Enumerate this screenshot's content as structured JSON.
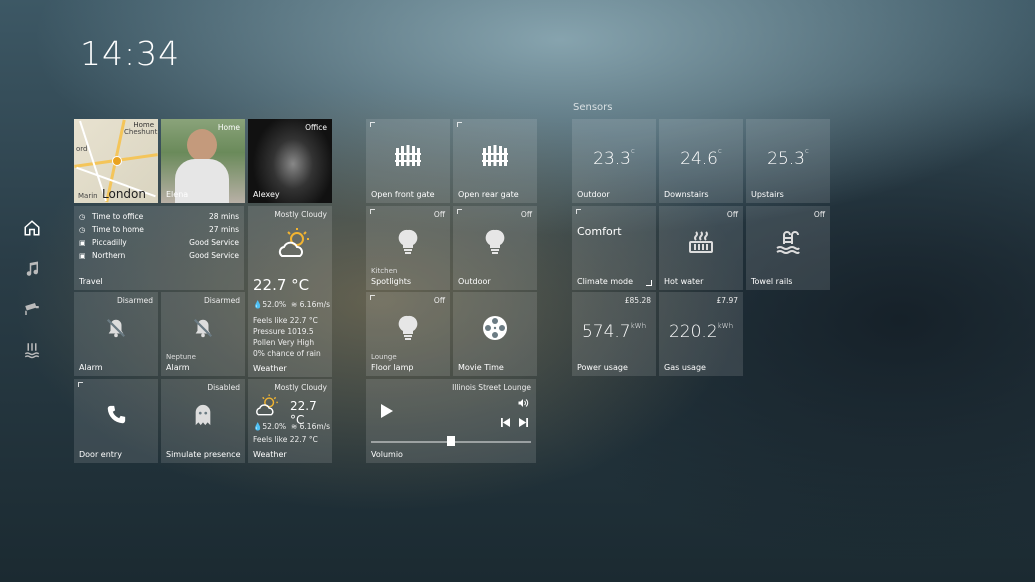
{
  "clock": "14:34",
  "sidebar": {
    "items": [
      {
        "icon": "home-icon"
      },
      {
        "icon": "music-icon"
      },
      {
        "icon": "camera-icon"
      },
      {
        "icon": "heating-icon"
      }
    ]
  },
  "sensors_title": "Sensors",
  "people": {
    "map": {
      "tag": "Home",
      "place_top": "Cheshunt",
      "place_left": "ord",
      "place_bottom": "Marin",
      "city": "London"
    },
    "elena": {
      "tag": "Home",
      "name": "Elena"
    },
    "alexey": {
      "tag": "Office",
      "name": "Alexey"
    }
  },
  "travel": {
    "rows": [
      {
        "icon": "clock",
        "label": "Time to office",
        "value": "28 mins"
      },
      {
        "icon": "clock",
        "label": "Time to home",
        "value": "27 mins"
      },
      {
        "icon": "train",
        "label": "Piccadilly",
        "value": "Good Service"
      },
      {
        "icon": "train",
        "label": "Northern",
        "value": "Good Service"
      }
    ],
    "label": "Travel"
  },
  "weather_big": {
    "condition": "Mostly Cloudy",
    "temp": "22.7 °C",
    "humidity": "52.0%",
    "wind": "6.16m/s",
    "feels": "Feels like 22.7 °C",
    "pressure": "Pressure 1019.5",
    "pollen": "Pollen Very High",
    "rain": "0% chance of rain",
    "label": "Weather"
  },
  "weather_small": {
    "condition": "Mostly Cloudy",
    "temp": "22.7 °C",
    "humidity": "52.0%",
    "wind": "6.16m/s",
    "feels": "Feels like 22.7 °C",
    "label": "Weather"
  },
  "alarm1": {
    "status": "Disarmed",
    "label": "Alarm"
  },
  "alarm2": {
    "status": "Disarmed",
    "sublabel": "Neptune",
    "label": "Alarm"
  },
  "door": {
    "label": "Door entry"
  },
  "presence": {
    "status": "Disabled",
    "label": "Simulate presence"
  },
  "gates": {
    "front": {
      "label": "Open front gate"
    },
    "rear": {
      "label": "Open rear gate"
    }
  },
  "lights": {
    "spotlights": {
      "status": "Off",
      "sublabel": "Kitchen",
      "label": "Spotlights"
    },
    "outdoor": {
      "status": "Off",
      "label": "Outdoor"
    },
    "floor": {
      "status": "Off",
      "sublabel": "Lounge",
      "label": "Floor lamp"
    },
    "movie": {
      "label": "Movie Time"
    }
  },
  "media": {
    "status": "Illinois Street Lounge",
    "label": "Volumio",
    "progress": 0.5
  },
  "sensors": {
    "outdoor": {
      "value": "23.3",
      "unit": "c",
      "label": "Outdoor"
    },
    "downstairs": {
      "value": "24.6",
      "unit": "c",
      "label": "Downstairs"
    },
    "upstairs": {
      "value": "25.3",
      "unit": "c",
      "label": "Upstairs"
    },
    "climate": {
      "value": "Comfort",
      "label": "Climate mode"
    },
    "hotwater": {
      "status": "Off",
      "label": "Hot water"
    },
    "towel": {
      "status": "Off",
      "label": "Towel rails"
    },
    "power": {
      "status": "£85.28",
      "value": "574.7",
      "unit": "kWh",
      "label": "Power usage"
    },
    "gas": {
      "status": "£7.97",
      "value": "220.2",
      "unit": "kWh",
      "label": "Gas usage"
    }
  },
  "colors": {
    "accent_sun": "#f2b431",
    "tile_bg": "rgba(255,255,255,0.12)"
  }
}
